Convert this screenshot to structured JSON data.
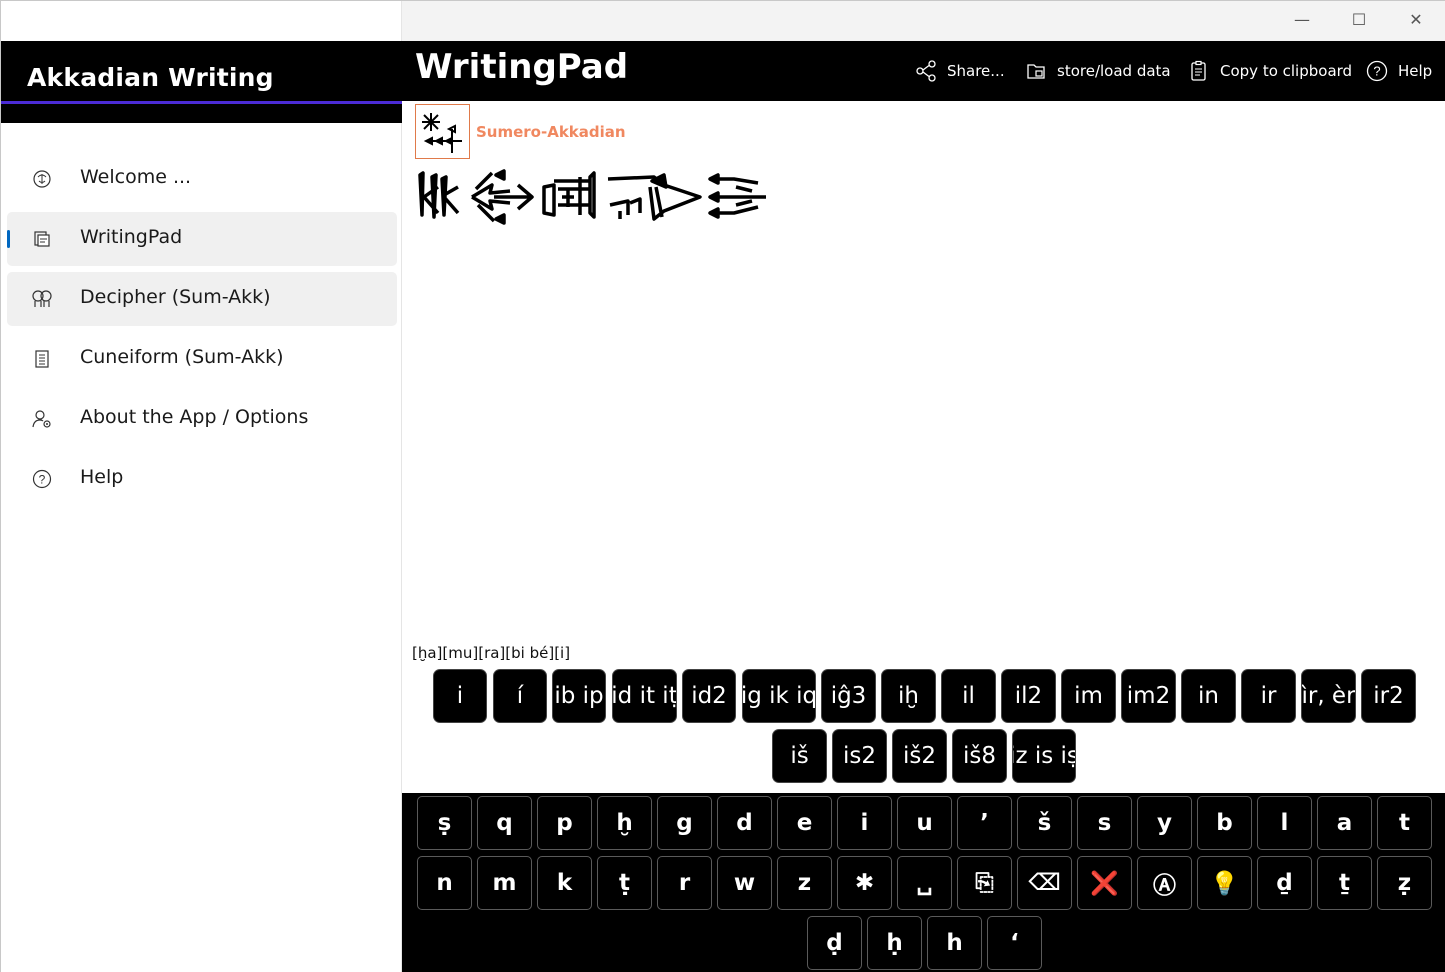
{
  "sidebar": {
    "title": "Akkadian Writing",
    "items": [
      {
        "label": "Welcome ...",
        "icon": "brain-icon"
      },
      {
        "label": "WritingPad",
        "icon": "writing-pad-icon",
        "selected": true
      },
      {
        "label": "Decipher (Sum-Akk)",
        "icon": "decipher-icon"
      },
      {
        "label": "Cuneiform (Sum-Akk)",
        "icon": "list-icon"
      },
      {
        "label": "About the App / Options",
        "icon": "person-gear-icon"
      },
      {
        "label": "Help",
        "icon": "help-icon"
      }
    ]
  },
  "window": {
    "minimize": "—",
    "maximize": "☐",
    "close": "✕"
  },
  "header": {
    "title": "WritingPad",
    "share": "Share...",
    "store": "store/load data",
    "copy": "Copy to clipboard",
    "help": "Help"
  },
  "content": {
    "language_label": "Sumero-Akkadian",
    "transliteration": "[ḫa][mu][ra][bi bé][i]"
  },
  "suggestions": {
    "row1": [
      "i",
      "í",
      "ib ip",
      "id it iṭ",
      "id2",
      "ig ik iq",
      "iĝ3",
      "iḫ",
      "il",
      "il2",
      "im",
      "im2",
      "in",
      "ir",
      "ìr, èr",
      "ir2"
    ],
    "row2": [
      "iš",
      "is2",
      "iš2",
      "iš8",
      "iz is iṣ"
    ]
  },
  "keyboard": {
    "row1": [
      "ṣ",
      "q",
      "p",
      "ḫ",
      "g",
      "d",
      "e",
      "i",
      "u",
      "’",
      "š",
      "s",
      "y",
      "b",
      "l",
      "a",
      "t"
    ],
    "row2": [
      "n",
      "m",
      "k",
      "ṭ",
      "r",
      "w",
      "z",
      "✱",
      "␣",
      "⎘",
      "⌫",
      "❌",
      "Ⓐ",
      "💡",
      "ḏ",
      "ṯ",
      "ẓ"
    ],
    "row3": [
      "ḍ",
      "ḥ",
      "h",
      "‘"
    ]
  },
  "colors": {
    "accent": "#4b2bd6",
    "nav_selected": "#0067c0",
    "language_label": "#f08860"
  }
}
